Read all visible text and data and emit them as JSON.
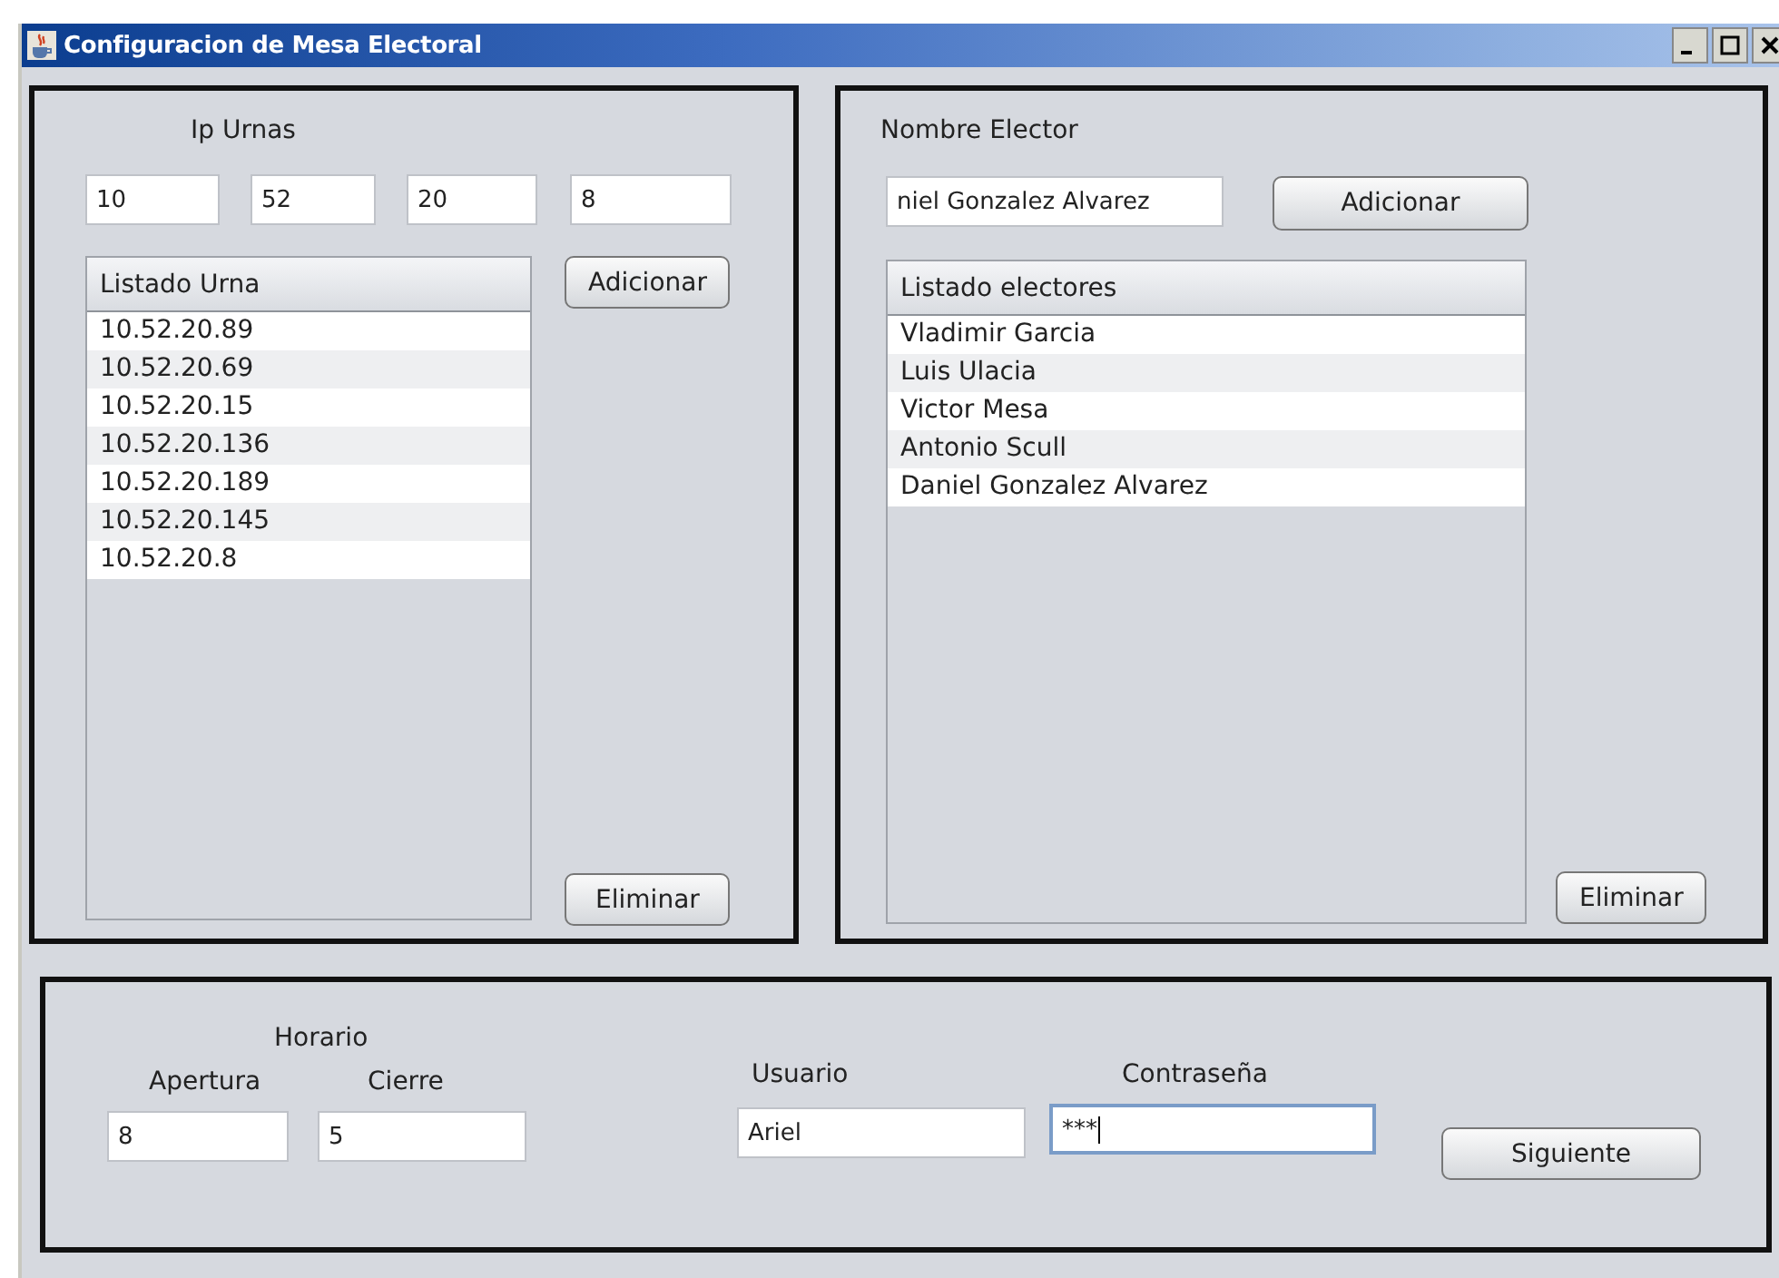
{
  "window": {
    "title": "Configuracion de Mesa Electoral"
  },
  "ip_panel": {
    "label": "Ip Urnas",
    "octets": [
      "10",
      "52",
      "20",
      "8"
    ],
    "add_button": "Adicionar",
    "list": {
      "header": "Listado Urna",
      "items": [
        "10.52.20.89",
        "10.52.20.69",
        "10.52.20.15",
        "10.52.20.136",
        "10.52.20.189",
        "10.52.20.145",
        "10.52.20.8"
      ]
    },
    "remove_button": "Eliminar"
  },
  "elector_panel": {
    "label": "Nombre Elector",
    "name_value": "niel Gonzalez Alvarez",
    "add_button": "Adicionar",
    "list": {
      "header": "Listado electores",
      "items": [
        "Vladimir Garcia",
        "Luis Ulacia",
        "Victor Mesa",
        "Antonio Scull",
        "Daniel Gonzalez Alvarez"
      ]
    },
    "remove_button": "Eliminar"
  },
  "bottom_panel": {
    "schedule_label": "Horario",
    "opening": {
      "label": "Apertura",
      "value": "8"
    },
    "closing": {
      "label": "Cierre",
      "value": "5"
    },
    "user": {
      "label": "Usuario",
      "value": "Ariel",
      "focused": false
    },
    "password": {
      "label": "Contraseña",
      "value": "***",
      "focused": true
    },
    "next_button": "Siguiente"
  }
}
